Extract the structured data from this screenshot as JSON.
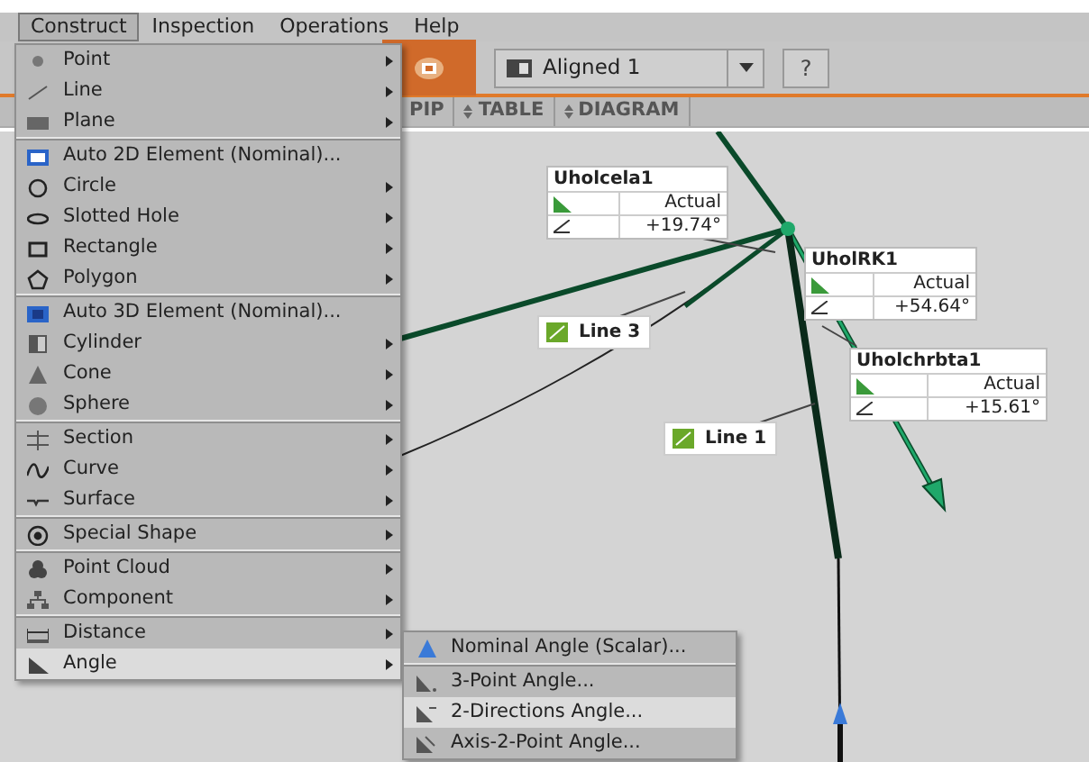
{
  "menubar": [
    {
      "label": "Construct",
      "selected": true
    },
    {
      "label": "Inspection",
      "selected": false
    },
    {
      "label": "Operations",
      "selected": false
    },
    {
      "label": "Help",
      "selected": false
    }
  ],
  "toolbar": {
    "view_dropdown": "Aligned 1",
    "help_button": "?"
  },
  "view_tabs": [
    "PIP",
    "TABLE",
    "DIAGRAM"
  ],
  "construct_menu": [
    [
      {
        "label": "Point",
        "submenu": true,
        "selected": false
      },
      {
        "label": "Line",
        "submenu": true,
        "selected": false
      },
      {
        "label": "Plane",
        "submenu": true,
        "selected": false
      }
    ],
    [
      {
        "label": "Auto 2D Element (Nominal)...",
        "submenu": false,
        "selected": false
      },
      {
        "label": "Circle",
        "submenu": true,
        "selected": false
      },
      {
        "label": "Slotted Hole",
        "submenu": true,
        "selected": false
      },
      {
        "label": "Rectangle",
        "submenu": true,
        "selected": false
      },
      {
        "label": "Polygon",
        "submenu": true,
        "selected": false
      }
    ],
    [
      {
        "label": "Auto 3D Element (Nominal)...",
        "submenu": false,
        "selected": false
      },
      {
        "label": "Cylinder",
        "submenu": true,
        "selected": false
      },
      {
        "label": "Cone",
        "submenu": true,
        "selected": false
      },
      {
        "label": "Sphere",
        "submenu": true,
        "selected": false
      }
    ],
    [
      {
        "label": "Section",
        "submenu": true,
        "selected": false
      },
      {
        "label": "Curve",
        "submenu": true,
        "selected": false
      },
      {
        "label": "Surface",
        "submenu": true,
        "selected": false
      }
    ],
    [
      {
        "label": "Special Shape",
        "submenu": true,
        "selected": false
      }
    ],
    [
      {
        "label": "Point Cloud",
        "submenu": true,
        "selected": false
      },
      {
        "label": "Component",
        "submenu": true,
        "selected": false
      }
    ],
    [
      {
        "label": "Distance",
        "submenu": true,
        "selected": false
      },
      {
        "label": "Angle",
        "submenu": true,
        "selected": true
      }
    ]
  ],
  "angle_submenu": [
    [
      {
        "label": "Nominal Angle (Scalar)...",
        "selected": false
      }
    ],
    [
      {
        "label": "3-Point Angle...",
        "selected": false
      },
      {
        "label": "2-Directions Angle...",
        "selected": true
      },
      {
        "label": "Axis-2-Point Angle...",
        "selected": false
      }
    ]
  ],
  "angle_labels": [
    {
      "title": "Uholcela1",
      "column": "Actual",
      "value": "+19.74°"
    },
    {
      "title": "UholRK1",
      "column": "Actual",
      "value": "+54.64°"
    },
    {
      "title": "Uholchrbta1",
      "column": "Actual",
      "value": "+15.61°"
    }
  ],
  "line_labels": [
    {
      "label": "Line 3"
    },
    {
      "label": "Line 1"
    }
  ]
}
